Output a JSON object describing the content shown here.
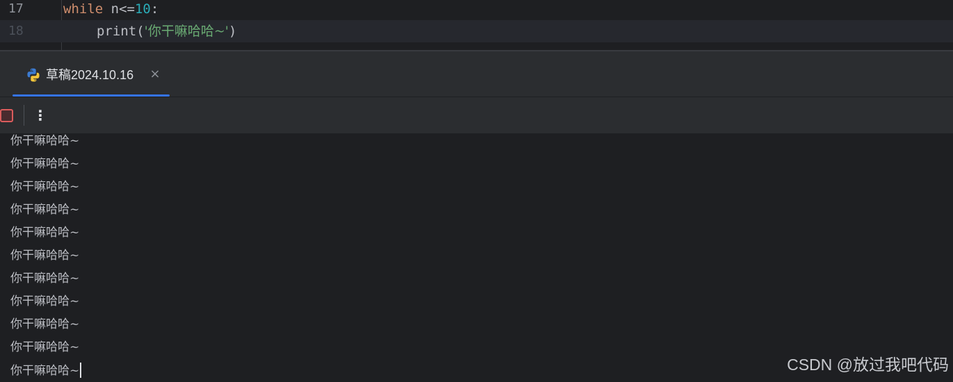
{
  "editor": {
    "lines": [
      {
        "number": "17",
        "keyword": "while",
        "rest": " n<=",
        "number_literal": "10",
        "tail": ":"
      },
      {
        "number": "18",
        "func": "print",
        "open": "(",
        "string": "'你干嘛哈哈~'",
        "close": ")"
      }
    ]
  },
  "run_tab": {
    "icon": "python-icon",
    "label": "草稿2024.10.16",
    "close": "×"
  },
  "toolbar": {
    "stop_icon": "stop-icon",
    "more_icon": "⋮"
  },
  "console": {
    "output_lines": [
      "你干嘛哈哈~",
      "你干嘛哈哈~",
      "你干嘛哈哈~",
      "你干嘛哈哈~",
      "你干嘛哈哈~",
      "你干嘛哈哈~",
      "你干嘛哈哈~",
      "你干嘛哈哈~",
      "你干嘛哈哈~",
      "你干嘛哈哈~",
      "你干嘛哈哈~"
    ]
  },
  "watermark": "CSDN @放过我吧代码",
  "colors": {
    "background": "#1e1f22",
    "panel": "#2b2d30",
    "keyword": "#cf8e6d",
    "number": "#2aacb8",
    "string": "#6aab73",
    "accent": "#3574f0",
    "stop": "#db5c5c"
  }
}
